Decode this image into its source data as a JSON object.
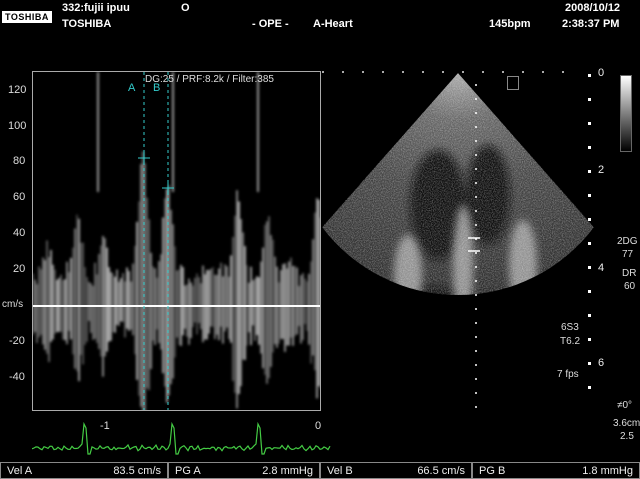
{
  "header": {
    "logo": "TOSHIBA",
    "patient_id": "332:fujii ipuu",
    "marker": "O",
    "brand": "TOSHIBA",
    "mode": "- OPE -",
    "preset": "A-Heart",
    "heart_rate": "145bpm",
    "date": "2008/10/12",
    "time": "2:38:37 PM"
  },
  "doppler": {
    "settings": "DG:25 /  PRF:8.2k  / Filter:385",
    "marker_a": "A",
    "marker_b": "B",
    "unit": "cm/s",
    "y_ticks": [
      "120",
      "100",
      "80",
      "60",
      "40",
      "20",
      "-20",
      "-40"
    ],
    "x_ticks": [
      "-1",
      "0"
    ]
  },
  "echo": {
    "gain": "2DG",
    "gain_value": "77",
    "dr_label": "DR",
    "dr_value": "60",
    "probe": "6S3",
    "tis": "T6.2",
    "fps": "7 fps",
    "angle": "≠0°",
    "depth_cm": "3.6cm",
    "focus": "2.5",
    "depth_ticks": [
      "0",
      "2",
      "4",
      "6"
    ]
  },
  "measurements": {
    "vel_a_label": "Vel A",
    "vel_a_value": "83.5  cm/s",
    "pg_a_label": "PG A",
    "pg_a_value": "2.8  mmHg",
    "vel_b_label": "Vel B",
    "vel_b_value": "66.5  cm/s",
    "pg_b_label": "PG B",
    "pg_b_value": "1.8  mmHg"
  }
}
